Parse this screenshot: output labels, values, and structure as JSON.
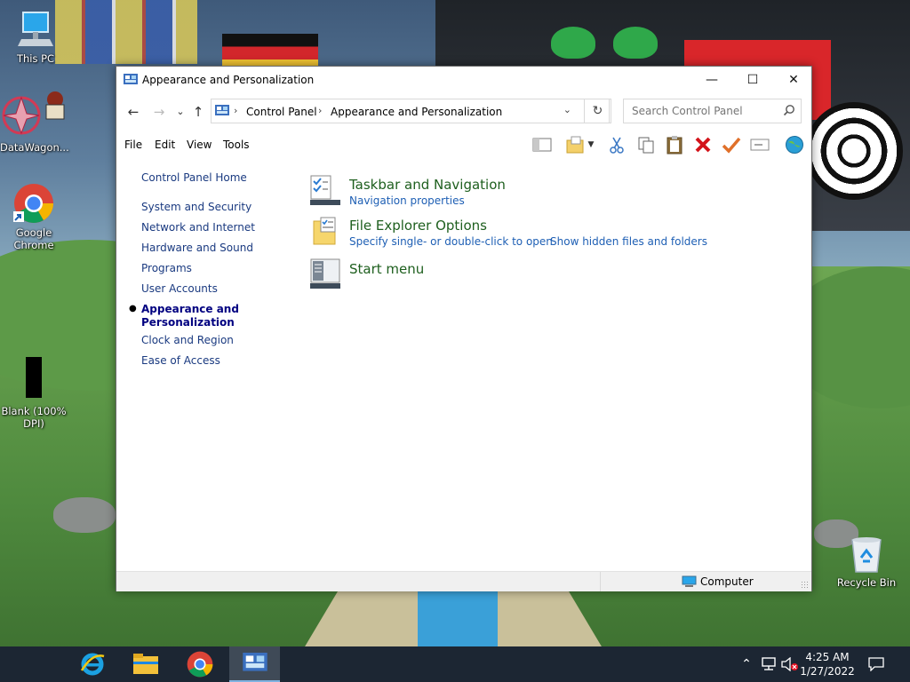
{
  "desktop": {
    "icons": [
      {
        "label": "This PC"
      },
      {
        "label": "DataWagon..."
      },
      {
        "label": "Google Chrome"
      },
      {
        "label": "Blank (100% DPI)"
      },
      {
        "label": "Recycle Bin"
      }
    ]
  },
  "window": {
    "title": "Appearance and Personalization",
    "controls": {
      "minimize": "—",
      "maximize": "☐",
      "close": "✕"
    },
    "nav": {
      "back": "←",
      "forward": "→",
      "recent": "⌄",
      "up": "↑",
      "refresh": "↻"
    },
    "address": {
      "crumbs": [
        "Control Panel",
        "Appearance and Personalization"
      ]
    },
    "search": {
      "placeholder": "Search Control Panel"
    },
    "menu": [
      "File",
      "Edit",
      "View",
      "Tools"
    ],
    "sidebar": {
      "home": "Control Panel Home",
      "items": [
        {
          "label": "System and Security"
        },
        {
          "label": "Network and Internet"
        },
        {
          "label": "Hardware and Sound"
        },
        {
          "label": "Programs"
        },
        {
          "label": "User Accounts"
        },
        {
          "label": "Appearance and Personalization",
          "active": true
        },
        {
          "label": "Clock and Region"
        },
        {
          "label": "Ease of Access"
        }
      ]
    },
    "categories": [
      {
        "title": "Taskbar and Navigation",
        "links": [
          "Navigation properties"
        ]
      },
      {
        "title": "File Explorer Options",
        "links": [
          "Specify single- or double-click to open",
          "Show hidden files and folders"
        ]
      },
      {
        "title": "Start menu",
        "links": []
      }
    ],
    "status": {
      "location": "Computer"
    }
  },
  "taskbar": {
    "clock": {
      "time": "4:25 AM",
      "date": "1/27/2022"
    }
  },
  "colors": {
    "link": "#1e5fb4",
    "category_title": "#1e5f1e",
    "taskbar": "#1c2633"
  }
}
